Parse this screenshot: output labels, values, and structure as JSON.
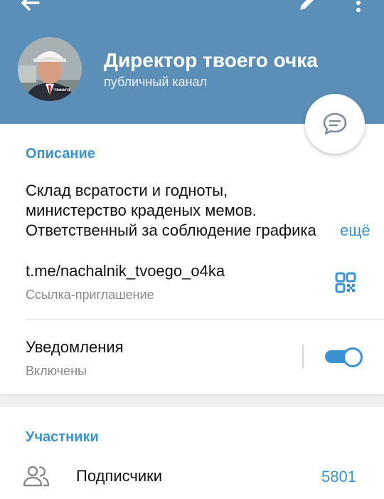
{
  "header": {
    "back_icon": "arrow-left-icon",
    "edit_icon": "pencil-icon",
    "more_icon": "more-vertical-icon",
    "channel_title": "Директор твоего очка",
    "channel_subtitle": "публичный канал",
    "avatar_label": "твоего",
    "color": "#5b8fb8"
  },
  "fab": {
    "icon": "comment-icon"
  },
  "info": {
    "description_title": "Описание",
    "description_lines": [
      "Склад всратости и годноты,",
      "министерство краденых мемов.",
      "Ответственный за соблюдение графика"
    ],
    "more_label": "ещё",
    "link_value": "t.me/nachalnik_tvoego_o4ka",
    "link_caption": "Ссылка-приглашение",
    "qr_icon": "qr-code-icon",
    "notifications_label": "Уведомления",
    "notifications_status": "Включены",
    "notifications_on": true
  },
  "members": {
    "title": "Участники",
    "subscribers_label": "Подписчики",
    "subscribers_count": "5801",
    "icon": "users-icon"
  },
  "colors": {
    "accent": "#3a92d0",
    "text": "#111111",
    "secondary": "#888888"
  }
}
